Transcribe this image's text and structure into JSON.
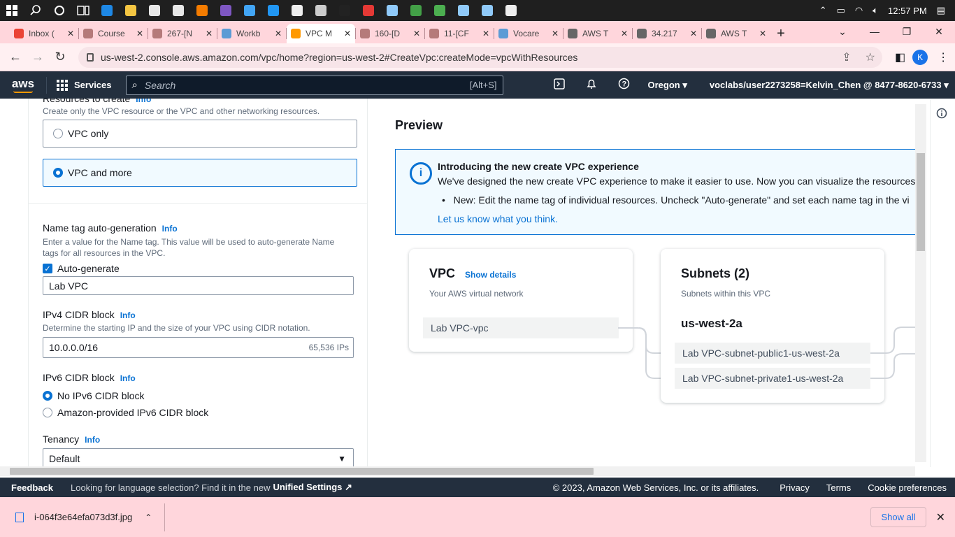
{
  "taskbar": {
    "time": "12:57 PM",
    "apps": [
      {
        "icon": "search-icon"
      },
      {
        "icon": "cortana-icon"
      },
      {
        "icon": "task-view-icon"
      },
      {
        "icon": "edge-icon",
        "color": "#1e88e5"
      },
      {
        "icon": "file-explorer-icon",
        "color": "#f4c542"
      },
      {
        "icon": "store-icon",
        "color": "#e8e8e8"
      },
      {
        "icon": "mail-icon",
        "color": "#e8e8e8"
      },
      {
        "icon": "vlc-icon",
        "color": "#f57c00"
      },
      {
        "icon": "app-icon",
        "color": "#7e57c2"
      },
      {
        "icon": "app-icon",
        "color": "#42a5f5"
      },
      {
        "icon": "vscode-icon",
        "color": "#2196f3"
      },
      {
        "icon": "git-icon",
        "color": "#eeeeee"
      },
      {
        "icon": "app-icon",
        "color": "#cccccc"
      },
      {
        "icon": "pycharm-icon",
        "color": "#222222"
      },
      {
        "icon": "chrome-icon",
        "color": "#e53935"
      },
      {
        "icon": "notepad-icon",
        "color": "#90caf9"
      },
      {
        "icon": "chrome-icon",
        "color": "#43a047"
      },
      {
        "icon": "wechat-icon",
        "color": "#4caf50"
      },
      {
        "icon": "virtualbox-icon",
        "color": "#90caf9"
      },
      {
        "icon": "virtualbox-icon",
        "color": "#90caf9"
      },
      {
        "icon": "settings-icon",
        "color": "#eeeeee"
      }
    ]
  },
  "tabs": [
    {
      "title": "Inbox (",
      "color": "#ea4335"
    },
    {
      "title": "Course",
      "color": "#b57a7a"
    },
    {
      "title": "267-[N",
      "color": "#b57a7a"
    },
    {
      "title": "Workb",
      "color": "#5b9bd5"
    },
    {
      "title": "VPC M",
      "color": "#ff9900",
      "active": true
    },
    {
      "title": "160-[D",
      "color": "#b57a7a"
    },
    {
      "title": "11-[CF",
      "color": "#b57a7a"
    },
    {
      "title": "Vocare",
      "color": "#5b9bd5"
    },
    {
      "title": "AWS T",
      "color": "#666666"
    },
    {
      "title": "34.217",
      "color": "#666666"
    },
    {
      "title": "AWS T",
      "color": "#666666"
    }
  ],
  "address": {
    "url": "us-west-2.console.aws.amazon.com/vpc/home?region=us-west-2#CreateVpc:createMode=vpcWithResources",
    "avatar": "K"
  },
  "awsnav": {
    "logo": "aws",
    "services": "Services",
    "search_placeholder": "Search",
    "search_shortcut": "[Alt+S]",
    "region": "Oregon",
    "account": "voclabs/user2273258=Kelvin_Chen @ 8477-8620-6733"
  },
  "form": {
    "resources_label": "Resources to create",
    "resources_info": "Info",
    "resources_hint": "Create only the VPC resource or the VPC and other networking resources.",
    "option_vpc_only": "VPC only",
    "option_vpc_more": "VPC and more",
    "nametag_label": "Name tag auto-generation",
    "nametag_info": "Info",
    "nametag_hint": "Enter a value for the Name tag. This value will be used to auto-generate Name tags for all resources in the VPC.",
    "autogen_label": "Auto-generate",
    "autogen_checked": true,
    "nametag_value": "Lab VPC",
    "ipv4_label": "IPv4 CIDR block",
    "ipv4_info": "Info",
    "ipv4_hint": "Determine the starting IP and the size of your VPC using CIDR notation.",
    "ipv4_value": "10.0.0.0/16",
    "ipv4_count": "65,536 IPs",
    "ipv6_label": "IPv6 CIDR block",
    "ipv6_info": "Info",
    "ipv6_option_none": "No IPv6 CIDR block",
    "ipv6_option_amazon": "Amazon-provided IPv6 CIDR block",
    "tenancy_label": "Tenancy",
    "tenancy_info": "Info",
    "tenancy_value": "Default"
  },
  "preview": {
    "title": "Preview",
    "banner_title": "Introducing the new create VPC experience",
    "banner_desc": "We've designed the new create VPC experience to make it easier to use. Now you can visualize the resources",
    "banner_bullet": "New: Edit the name tag of individual resources. Uncheck \"Auto-generate\" and set each name tag in the vi",
    "banner_link": "Let us know what you think.",
    "vpc_title": "VPC",
    "vpc_show_details": "Show details",
    "vpc_desc": "Your AWS virtual network",
    "vpc_name": "Lab VPC-vpc",
    "subnets_title": "Subnets (2)",
    "subnets_desc": "Subnets within this VPC",
    "az": "us-west-2a",
    "subnet_public": "Lab VPC-subnet-public1-us-west-2a",
    "subnet_private": "Lab VPC-subnet-private1-us-west-2a"
  },
  "footer": {
    "feedback": "Feedback",
    "lang_text": "Looking for language selection? Find it in the new",
    "unified": "Unified Settings",
    "copyright": "© 2023, Amazon Web Services, Inc. or its affiliates.",
    "privacy": "Privacy",
    "terms": "Terms",
    "cookies": "Cookie preferences"
  },
  "downloads": {
    "file": "i-064f3e64efa073d3f.jpg",
    "show_all": "Show all"
  }
}
